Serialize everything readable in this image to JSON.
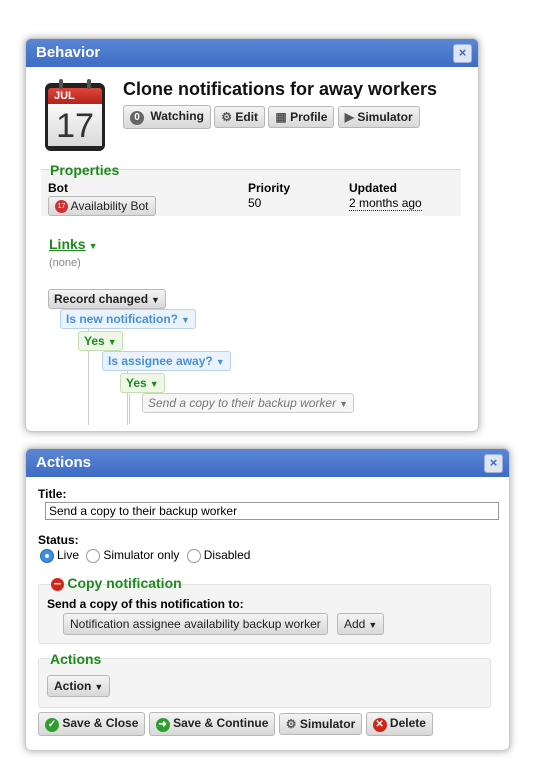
{
  "behavior": {
    "header": "Behavior",
    "close": "×",
    "calendar": {
      "month": "JUL",
      "day": "17"
    },
    "title": "Clone notifications for away workers",
    "toolbar": {
      "watching_count": "0",
      "watching": "Watching",
      "edit": "Edit",
      "profile": "Profile",
      "simulator": "Simulator"
    },
    "properties": {
      "legend": "Properties",
      "bot_label": "Bot",
      "bot_value": "Availability Bot",
      "bot_icon_day": "17",
      "priority_label": "Priority",
      "priority_value": "50",
      "updated_label": "Updated",
      "updated_value": "2 months ago"
    },
    "links": {
      "label": "Links",
      "value": "(none)"
    },
    "tree": {
      "record_changed": "Record changed",
      "is_new": "Is new notification?",
      "yes1": "Yes",
      "is_away": "Is assignee away?",
      "yes2": "Yes",
      "action": "Send a copy to their backup worker"
    }
  },
  "actions": {
    "header": "Actions",
    "close": "×",
    "title_label": "Title:",
    "title_value": "Send a copy to their backup worker",
    "status_label": "Status:",
    "status_options": [
      "Live",
      "Simulator only",
      "Disabled"
    ],
    "status_selected": "Live",
    "copy": {
      "legend": "Copy notification",
      "label": "Send a copy of this notification to:",
      "target": "Notification assignee availability backup worker",
      "add": "Add"
    },
    "actions_section": {
      "legend": "Actions",
      "button": "Action"
    },
    "footer": {
      "save_close": "Save & Close",
      "save_continue": "Save & Continue",
      "simulator": "Simulator",
      "delete": "Delete"
    }
  },
  "colors": {
    "header": "#4a76cc",
    "green": "#1e8a1e",
    "blue": "#4a90d6"
  }
}
